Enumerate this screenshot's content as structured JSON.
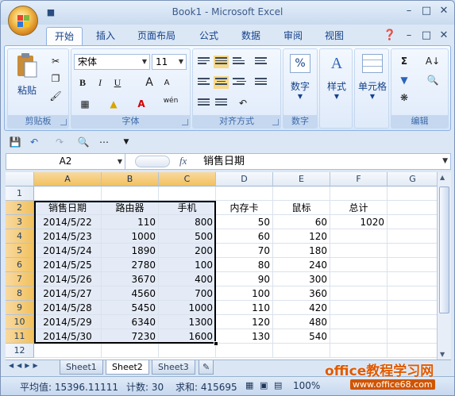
{
  "window": {
    "title": "Book1 - Microsoft Excel"
  },
  "tabs": [
    "开始",
    "插入",
    "页面布局",
    "公式",
    "数据",
    "审阅",
    "视图"
  ],
  "active_tab": "开始",
  "ribbon": {
    "clipboard": {
      "label": "剪贴板",
      "paste": "粘贴"
    },
    "font": {
      "label": "字体",
      "font_name": "宋体",
      "font_size": "11",
      "bold": "B",
      "italic": "I",
      "underline": "U",
      "grow": "A",
      "shrink": "A",
      "phonetic": "wén"
    },
    "alignment": {
      "label": "对齐方式"
    },
    "number": {
      "label": "数字",
      "btn": "数字",
      "symbol": "%"
    },
    "styles": {
      "btn": "样式"
    },
    "cells": {
      "btn": "单元格"
    },
    "editing": {
      "label": "编辑",
      "sum": "Σ"
    }
  },
  "formula_bar": {
    "name_box": "A2",
    "fx": "fx",
    "content": "销售日期"
  },
  "columns": [
    "A",
    "B",
    "C",
    "D",
    "E",
    "F",
    "G"
  ],
  "rows": [
    "1",
    "2",
    "3",
    "4",
    "5",
    "6",
    "7",
    "8",
    "9",
    "10",
    "11",
    "12"
  ],
  "table": {
    "headers": [
      "销售日期",
      "路由器",
      "手机",
      "内存卡",
      "鼠标",
      "总计"
    ],
    "data": [
      [
        "2014/5/22",
        "110",
        "800",
        "50",
        "60",
        "1020"
      ],
      [
        "2014/5/23",
        "1000",
        "500",
        "60",
        "120",
        ""
      ],
      [
        "2014/5/24",
        "1890",
        "200",
        "70",
        "180",
        ""
      ],
      [
        "2014/5/25",
        "2780",
        "100",
        "80",
        "240",
        ""
      ],
      [
        "2014/5/26",
        "3670",
        "400",
        "90",
        "300",
        ""
      ],
      [
        "2014/5/27",
        "4560",
        "700",
        "100",
        "360",
        ""
      ],
      [
        "2014/5/28",
        "5450",
        "1000",
        "110",
        "420",
        ""
      ],
      [
        "2014/5/29",
        "6340",
        "1300",
        "120",
        "480",
        ""
      ],
      [
        "2014/5/30",
        "7230",
        "1600",
        "130",
        "540",
        ""
      ]
    ]
  },
  "sheets": [
    "Sheet1",
    "Sheet2",
    "Sheet3"
  ],
  "active_sheet": "Sheet2",
  "status": {
    "average": "平均值: 15396.11111",
    "count": "计数: 30",
    "sum": "求和: 415695",
    "zoom": "100%"
  },
  "watermark": {
    "text": "office教程学习网",
    "url": "www.office68.com"
  },
  "colors": {
    "accent": "#15428b",
    "selection_header": "#f1c15f",
    "ribbon_bg": "#dbe7f5"
  }
}
